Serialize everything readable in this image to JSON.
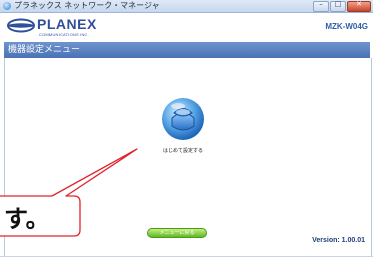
{
  "window": {
    "title": "プラネックス ネットワーク・マネージャ",
    "buttons": [
      {
        "name": "minimize",
        "glyph": "–"
      },
      {
        "name": "maximize",
        "glyph": "□"
      },
      {
        "name": "close",
        "glyph": "✕"
      }
    ]
  },
  "header": {
    "logo_text": "PLANEX",
    "logo_subtext": "COMMUNICATIONS INC.",
    "model": "MZK-W04G"
  },
  "menu_bar": {
    "title": "機器設定メニュー"
  },
  "main": {
    "first_setup_label": "はじめて設定する",
    "back_button_label": "メニューに戻る",
    "version": "Version: 1.00.01"
  },
  "callout": {
    "text": "す。",
    "color": "#e0242c"
  },
  "colors": {
    "menu_bar": "#5a80c0",
    "logo": "#2f4f9a",
    "back_button": "#7ccc3a"
  }
}
